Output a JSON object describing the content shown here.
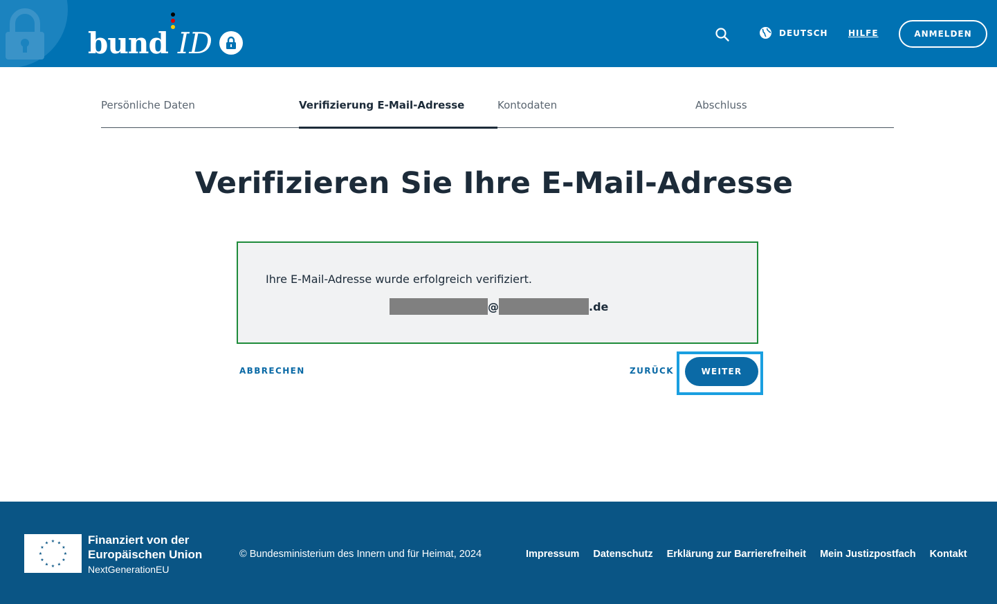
{
  "header": {
    "logo_bund": "bund",
    "logo_id": "ID",
    "language_label": "DEUTSCH",
    "help_label": "HILFE",
    "login_label": "ANMELDEN",
    "brand_color": "#0072b3"
  },
  "stepper": {
    "steps": [
      {
        "label": "Persönliche Daten",
        "active": false
      },
      {
        "label": "Verifizierung E-Mail-Adresse",
        "active": true
      },
      {
        "label": "Kontodaten",
        "active": false
      },
      {
        "label": "Abschluss",
        "active": false
      }
    ]
  },
  "main": {
    "title": "Verifizieren Sie Ihre E-Mail-Adresse",
    "success_message": "Ihre E-Mail-Adresse wurde erfolgreich verifiziert.",
    "email_at": "@",
    "email_suffix": ".de",
    "success_border_color": "#1e8b3a"
  },
  "actions": {
    "cancel_label": "ABBRECHEN",
    "back_label": "ZURÜCK",
    "next_label": "WEITER"
  },
  "footer": {
    "eu_line1": "Finanziert von der",
    "eu_line2": "Europäischen Union",
    "eu_line3": "NextGenerationEU",
    "copyright": "© Bundesministerium des Innern und für Heimat, 2024",
    "links": [
      "Impressum",
      "Datenschutz",
      "Erklärung zur Barrierefreiheit",
      "Mein Justizpostfach",
      "Kontakt"
    ],
    "background_color": "#0a5585"
  }
}
